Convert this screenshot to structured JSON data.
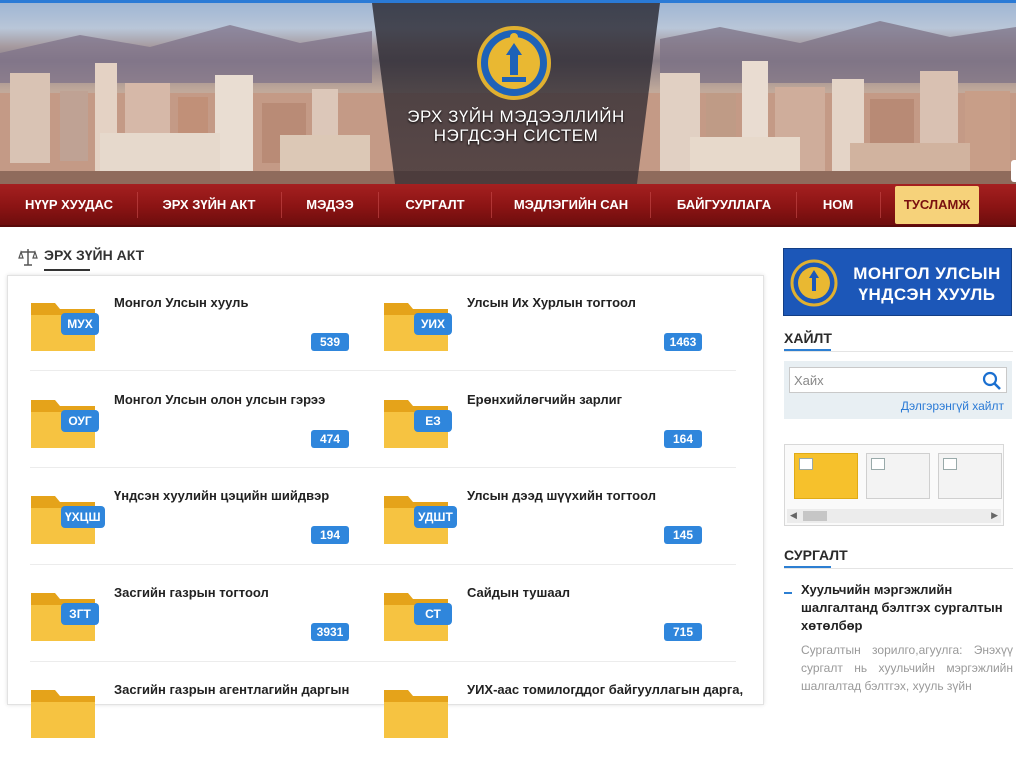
{
  "header": {
    "title_line1": "ЭРХ ЗҮЙН МЭДЭЭЛЛИЙН",
    "title_line2": "НЭГДСЭН СИСТЕМ"
  },
  "nav": {
    "items": [
      {
        "label": "НҮҮР ХУУДАС"
      },
      {
        "label": "ЭРХ ЗҮЙН АКТ"
      },
      {
        "label": "МЭДЭЭ"
      },
      {
        "label": "СУРГАЛТ"
      },
      {
        "label": "МЭДЛЭГИЙН САН"
      },
      {
        "label": "БАЙГУУЛЛАГА"
      },
      {
        "label": "НОМ"
      },
      {
        "label": "ТУСЛАМЖ",
        "active": true
      }
    ],
    "accent": "#f6d27a"
  },
  "main": {
    "section_title": "ЭРХ ЗҮЙН АКТ",
    "categories": [
      {
        "tag": "МУХ",
        "label": "Монгол Улсын хууль",
        "count": "539"
      },
      {
        "tag": "УИХ",
        "label": "Улсын Их Хурлын тогтоол",
        "count": "1463"
      },
      {
        "tag": "ОУГ",
        "label": "Монгол Улсын олон улсын гэрээ",
        "count": "474"
      },
      {
        "tag": "ЕЗ",
        "label": "Ерөнхийлөгчийн зарлиг",
        "count": "164"
      },
      {
        "tag": "ҮХЦШ",
        "label": "Үндсэн хуулийн цэцийн шийдвэр",
        "count": "194"
      },
      {
        "tag": "УДШТ",
        "label": "Улсын дээд шүүхийн тогтоол",
        "count": "145"
      },
      {
        "tag": "ЗГТ",
        "label": "Засгийн газрын тогтоол",
        "count": "3931"
      },
      {
        "tag": "СТ",
        "label": "Сайдын тушаал",
        "count": "715"
      },
      {
        "tag": "",
        "label": "Засгийн газрын агентлагийн даргын",
        "count": ""
      },
      {
        "tag": "",
        "label": "УИХ-аас томилогддог байгууллагын дарга,",
        "count": ""
      }
    ],
    "badge_color": "#2f86dc"
  },
  "sidebar": {
    "constitution_line1": "МОНГОЛ УЛСЫН",
    "constitution_line2": "ҮНДСЭН ХУУЛЬ",
    "search_heading": "ХАЙЛТ",
    "search_placeholder": "Хайх",
    "advanced_search": "Дэлгэрэнгүй хайлт",
    "training_heading": "СУРГАЛТ",
    "news_title": "Хуульчийн мэргэжлийн шалгалтанд бэлтгэх сургалтын хөтөлбөр",
    "news_body": "Сургалтын зорилго,агуулга: Энэхүү сургалт нь хуульчийн мэргэжлийн шалгалтад бэлтгэх, хууль зүйн"
  }
}
